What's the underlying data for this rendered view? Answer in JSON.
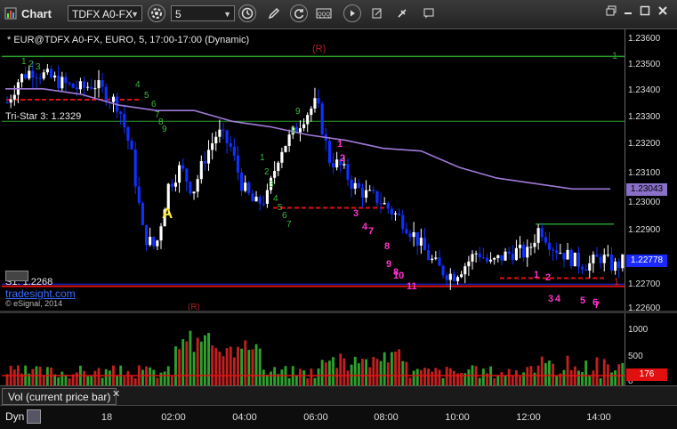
{
  "window": {
    "title": "Chart",
    "symbol_value": "TDFX A0-FX",
    "interval_value": "5",
    "colors": {
      "titlebar": "#2b2b2b",
      "bull": "#ffffff",
      "bear": "#1030ff"
    }
  },
  "chart_header": "* EUR@TDFX A0-FX, EURO, 5, 17:00-17:00 (Dynamic)",
  "annotations": {
    "tristar": "Tri-Star 3: 1.2329",
    "s1": "S1: 1.2268",
    "tradesight": "tradesight.com",
    "copyright": "© eSignal, 2014",
    "letter_a": "A",
    "r_top": "(R)",
    "r_bottom": "(R)",
    "line_end_top": "1",
    "line_end_bottom": "1",
    "magenta_labels": [
      "1",
      "2",
      "3",
      "4",
      "7",
      "8",
      "9",
      "10",
      "11",
      "1",
      "2",
      "3",
      "4",
      "5",
      "6",
      "7",
      "8"
    ],
    "green_labels": [
      "1",
      "2",
      "3",
      "4",
      "5",
      "6",
      "7",
      "8",
      "9",
      "1",
      "2",
      "3",
      "4",
      "5",
      "6",
      "7",
      "8",
      "9"
    ]
  },
  "price_axis": {
    "ticks": [
      "1.23600",
      "1.23500",
      "1.23400",
      "1.23300",
      "1.23200",
      "1.23100",
      "1.23000",
      "1.22900",
      "1.22800",
      "1.22700",
      "1.22600"
    ],
    "current_ma": "1.23043",
    "current_price": "1.22778"
  },
  "volume_panel": {
    "label": "Vol (current price bar)",
    "ticks": [
      "1000",
      "500",
      "0"
    ],
    "current_volume": "176"
  },
  "time_axis": {
    "mode": "Dyn",
    "labels": [
      "18",
      "02:00",
      "04:00",
      "06:00",
      "08:00",
      "10:00",
      "12:00",
      "14:00"
    ]
  },
  "chart_data": {
    "type": "candlestick",
    "title": "* EUR@TDFX A0-FX, EURO, 5, 17:00-17:00 (Dynamic)",
    "y_range": [
      1.2259,
      1.2363
    ],
    "levels": {
      "resistance_green": 1.2353,
      "tristar": 1.2329,
      "s1": 1.2268,
      "ma_last": 1.23043,
      "last_price": 1.22778
    },
    "price_path": [
      1.2336,
      1.2345,
      1.2348,
      1.2346,
      1.2344,
      1.2342,
      1.2341,
      1.2343,
      1.2339,
      1.2335,
      1.2318,
      1.2287,
      1.2282,
      1.2305,
      1.2312,
      1.2303,
      1.2316,
      1.2325,
      1.232,
      1.2305,
      1.2298,
      1.2301,
      1.2318,
      1.2324,
      1.2331,
      1.2336,
      1.2315,
      1.2312,
      1.2305,
      1.2302,
      1.23,
      1.2296,
      1.2292,
      1.2286,
      1.2279,
      1.2274,
      1.2272,
      1.2276,
      1.2281,
      1.2276,
      1.2279,
      1.2281,
      1.228,
      1.229,
      1.2283,
      1.228,
      1.2277,
      1.2276,
      1.2279,
      1.2275,
      1.2278
    ],
    "ma_path": [
      1.2341,
      1.2341,
      1.2339,
      1.2335,
      1.2333,
      1.2333,
      1.2329,
      1.2327,
      1.2324,
      1.2322,
      1.2319,
      1.2318,
      1.2312,
      1.2308,
      1.2306,
      1.2304,
      1.2304
    ],
    "volume": {
      "range": [
        0,
        1200
      ],
      "current": 176
    },
    "legend": "none",
    "grid": false
  }
}
